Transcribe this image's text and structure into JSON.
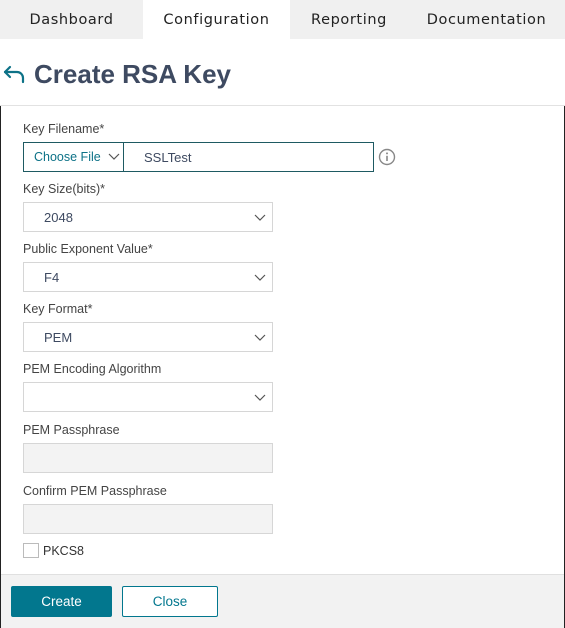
{
  "tabs": [
    {
      "label": "Dashboard",
      "active": false
    },
    {
      "label": "Configuration",
      "active": true
    },
    {
      "label": "Reporting",
      "active": false
    },
    {
      "label": "Documentation",
      "active": false
    }
  ],
  "header": {
    "back_icon": "back-arrow-icon",
    "title": "Create RSA Key"
  },
  "form": {
    "key_filename": {
      "label": "Key Filename*",
      "choose_file_label": "Choose File",
      "value": "SSLTest",
      "info_icon": "info-circle-icon"
    },
    "key_size": {
      "label": "Key Size(bits)*",
      "value": "2048"
    },
    "public_exponent": {
      "label": "Public Exponent Value*",
      "value": "F4"
    },
    "key_format": {
      "label": "Key Format*",
      "value": "PEM"
    },
    "pem_encoding": {
      "label": "PEM Encoding Algorithm",
      "value": ""
    },
    "pem_passphrase": {
      "label": "PEM Passphrase",
      "value": ""
    },
    "confirm_pem_passphrase": {
      "label": "Confirm PEM Passphrase",
      "value": ""
    },
    "pkcs8": {
      "label": "PKCS8",
      "checked": false
    }
  },
  "footer": {
    "create_label": "Create",
    "close_label": "Close"
  },
  "colors": {
    "accent": "#02778e",
    "title": "#3e4a61",
    "tab_bar": "#f0f0f0"
  }
}
